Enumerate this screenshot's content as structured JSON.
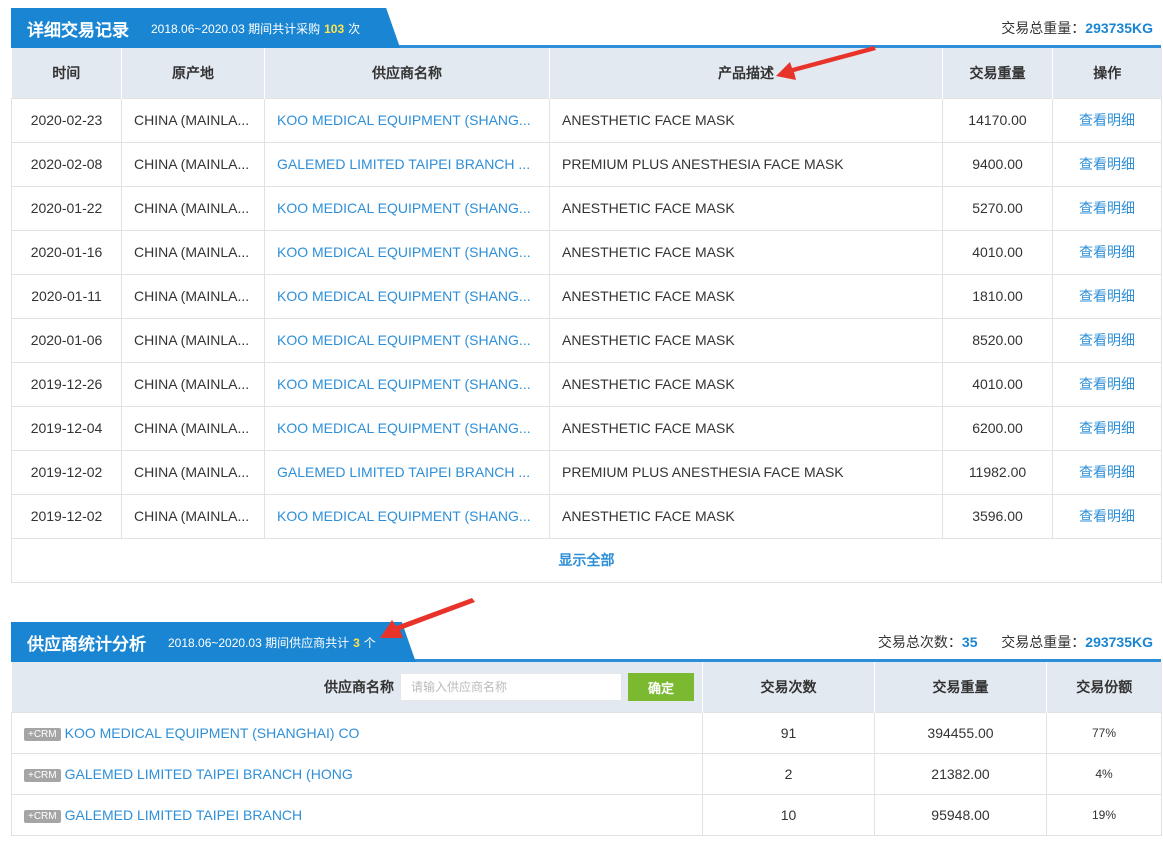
{
  "records": {
    "title": "详细交易记录",
    "period": "2018.06~2020.03 期间共计采购",
    "count": "103",
    "count_unit": "次",
    "total_label": "交易总重量：",
    "total_value": "293735KG",
    "columns": [
      "时间",
      "原产地",
      "供应商名称",
      "产品描述",
      "交易重量",
      "操作"
    ],
    "rows": [
      {
        "date": "2020-02-23",
        "origin": "CHINA (MAINLA...",
        "supplier": "KOO MEDICAL EQUIPMENT (SHANG...",
        "product": "ANESTHETIC FACE MASK",
        "weight": "14170.00",
        "action": "查看明细"
      },
      {
        "date": "2020-02-08",
        "origin": "CHINA (MAINLA...",
        "supplier": "GALEMED LIMITED TAIPEI BRANCH ...",
        "product": "PREMIUM PLUS ANESTHESIA FACE MASK",
        "weight": "9400.00",
        "action": "查看明细"
      },
      {
        "date": "2020-01-22",
        "origin": "CHINA (MAINLA...",
        "supplier": "KOO MEDICAL EQUIPMENT (SHANG...",
        "product": "ANESTHETIC FACE MASK",
        "weight": "5270.00",
        "action": "查看明细"
      },
      {
        "date": "2020-01-16",
        "origin": "CHINA (MAINLA...",
        "supplier": "KOO MEDICAL EQUIPMENT (SHANG...",
        "product": "ANESTHETIC FACE MASK",
        "weight": "4010.00",
        "action": "查看明细"
      },
      {
        "date": "2020-01-11",
        "origin": "CHINA (MAINLA...",
        "supplier": "KOO MEDICAL EQUIPMENT (SHANG...",
        "product": "ANESTHETIC FACE MASK",
        "weight": "1810.00",
        "action": "查看明细"
      },
      {
        "date": "2020-01-06",
        "origin": "CHINA (MAINLA...",
        "supplier": "KOO MEDICAL EQUIPMENT (SHANG...",
        "product": "ANESTHETIC FACE MASK",
        "weight": "8520.00",
        "action": "查看明细"
      },
      {
        "date": "2019-12-26",
        "origin": "CHINA (MAINLA...",
        "supplier": "KOO MEDICAL EQUIPMENT (SHANG...",
        "product": "ANESTHETIC FACE MASK",
        "weight": "4010.00",
        "action": "查看明细"
      },
      {
        "date": "2019-12-04",
        "origin": "CHINA (MAINLA...",
        "supplier": "KOO MEDICAL EQUIPMENT (SHANG...",
        "product": "ANESTHETIC FACE MASK",
        "weight": "6200.00",
        "action": "查看明细"
      },
      {
        "date": "2019-12-02",
        "origin": "CHINA (MAINLA...",
        "supplier": "GALEMED LIMITED TAIPEI BRANCH ...",
        "product": "PREMIUM PLUS ANESTHESIA FACE MASK",
        "weight": "11982.00",
        "action": "查看明细"
      },
      {
        "date": "2019-12-02",
        "origin": "CHINA (MAINLA...",
        "supplier": "KOO MEDICAL EQUIPMENT (SHANG...",
        "product": "ANESTHETIC FACE MASK",
        "weight": "3596.00",
        "action": "查看明细"
      }
    ],
    "show_all": "显示全部"
  },
  "suppliers": {
    "title": "供应商统计分析",
    "period": "2018.06~2020.03 期间供应商共计",
    "count": "3",
    "count_unit": "个",
    "total_count_label": "交易总次数：",
    "total_count_value": "35",
    "total_weight_label": "交易总重量：",
    "total_weight_value": "293735KG",
    "filter_label": "供应商名称",
    "filter_placeholder": "请输入供应商名称",
    "confirm_label": "确定",
    "columns": [
      "交易次数",
      "交易重量",
      "交易份额"
    ],
    "crm_label": "+CRM",
    "rows": [
      {
        "name": "KOO MEDICAL EQUIPMENT (SHANGHAI) CO",
        "count": "91",
        "weight": "394455.00",
        "share": "77%"
      },
      {
        "name": "GALEMED LIMITED TAIPEI BRANCH (HONG",
        "count": "2",
        "weight": "21382.00",
        "share": "4%"
      },
      {
        "name": "GALEMED LIMITED TAIPEI BRANCH",
        "count": "10",
        "weight": "95948.00",
        "share": "19%"
      }
    ]
  },
  "colors": {
    "accent": "#1a86d3",
    "highlight": "#ffe34a",
    "link": "#2e8fd8",
    "confirm": "#7ab930",
    "annotation_arrow": "#e8332a"
  },
  "icons": [
    "annotation-arrow-icon"
  ]
}
